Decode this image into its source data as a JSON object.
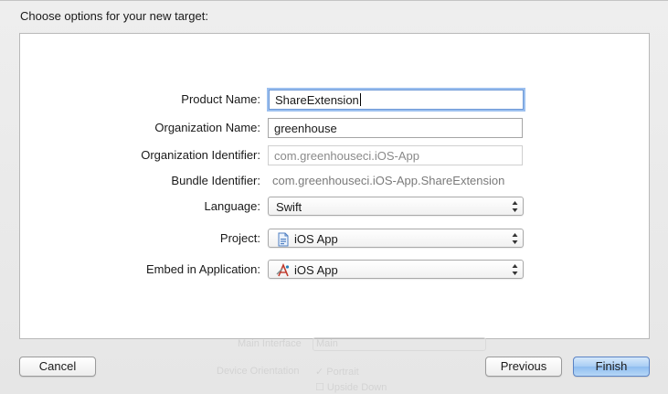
{
  "dialog": {
    "title": "Choose options for your new target:"
  },
  "form": {
    "product_name": {
      "label": "Product Name:",
      "value": "ShareExtension"
    },
    "organization_name": {
      "label": "Organization Name:",
      "value": "greenhouse"
    },
    "organization_identifier": {
      "label": "Organization Identifier:",
      "placeholder": "com.greenhouseci.iOS-App"
    },
    "bundle_identifier": {
      "label": "Bundle Identifier:",
      "value": "com.greenhouseci.iOS-App.ShareExtension"
    },
    "language": {
      "label": "Language:",
      "value": "Swift",
      "icon": "none"
    },
    "project": {
      "label": "Project:",
      "value": "iOS App",
      "icon": "xcode-project-icon"
    },
    "embed": {
      "label": "Embed in Application:",
      "value": "iOS App",
      "icon": "app-target-icon"
    }
  },
  "background": {
    "main_interface_label": "Main Interface",
    "main_interface_value": "Main",
    "device_orientation_label": "Device Orientation",
    "portrait_label": "Portrait",
    "upside_down_label": "Upside Down"
  },
  "buttons": {
    "cancel": "Cancel",
    "previous": "Previous",
    "finish": "Finish"
  },
  "colors": {
    "focus_ring": "#9cc0ef",
    "default_button": "#8fbdf0",
    "panel_bg": "#ffffff",
    "sheet_bg": "#ececec"
  }
}
